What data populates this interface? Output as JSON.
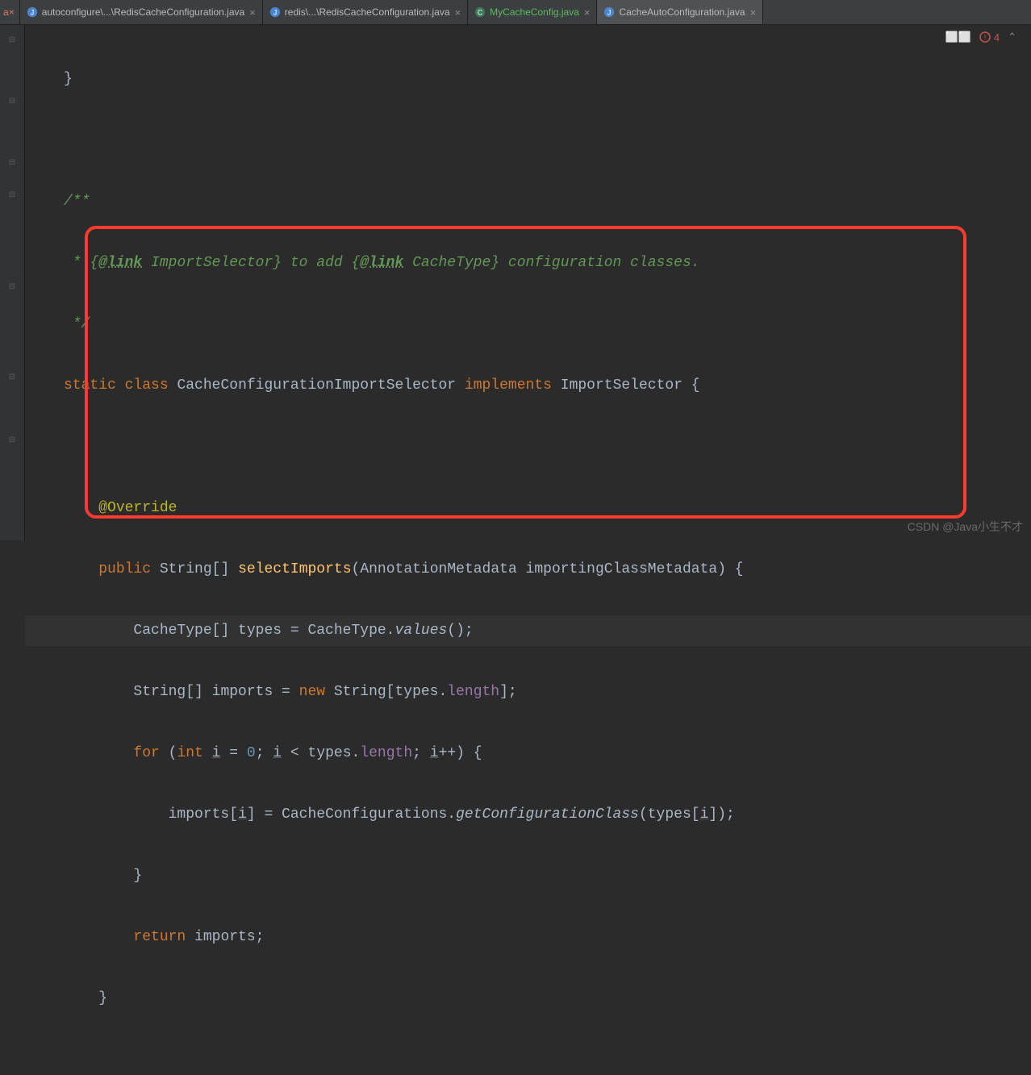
{
  "tabs": {
    "partial_close": "×",
    "t0": {
      "label": "autoconfigure\\...\\RedisCacheConfiguration.java",
      "close": "×"
    },
    "t1": {
      "label": "redis\\...\\RedisCacheConfiguration.java",
      "close": "×"
    },
    "t2": {
      "label": "MyCacheConfig.java",
      "close": "×"
    },
    "t3": {
      "label": "CacheAutoConfiguration.java",
      "close": "×"
    }
  },
  "status": {
    "err_count": "4",
    "chevron": "⌃"
  },
  "code": {
    "l1": "}",
    "l3": "/**",
    "l4_a": " * {",
    "l4_link1": "@link",
    "l4_b": " ImportSelector}",
    "l4_c": " to add {",
    "l4_link2": "@link",
    "l4_d": " CacheType}",
    "l4_e": " configuration classes.",
    "l5": " */",
    "l6_kw1": "static",
    "l6_kw2": "class",
    "l6_cls": "CacheConfigurationImportSelector",
    "l6_kw3": "implements",
    "l6_iface": "ImportSelector {",
    "l8_ann": "@Override",
    "l9_kw": "public",
    "l9_ret": "String[]",
    "l9_m": "selectImports",
    "l9_p": "(AnnotationMetadata importingClassMetadata) {",
    "l10_a": "CacheType[] types = CacheType.",
    "l10_m": "values",
    "l10_b": "();",
    "l11_a": "String[] imports = ",
    "l11_kw": "new",
    "l11_b": " String[types.",
    "l11_f": "length",
    "l11_c": "];",
    "l12_kw": "for",
    "l12_a": " (",
    "l12_int": "int",
    "l12_b": " ",
    "l12_i1": "i",
    "l12_c": " = ",
    "l12_num": "0",
    "l12_d": "; ",
    "l12_i2": "i",
    "l12_e": " < types.",
    "l12_f": "length",
    "l12_g": "; ",
    "l12_i3": "i",
    "l12_h": "++) {",
    "l13_a": "imports[",
    "l13_i": "i",
    "l13_b": "] = CacheConfigurations.",
    "l13_m": "getConfigurationClass",
    "l13_c": "(types[",
    "l13_i2": "i",
    "l13_d": "]);",
    "l14": "}",
    "l15_kw": "return",
    "l15_a": " imports;",
    "l16": "}"
  },
  "watermark": "CSDN @Java小生不才"
}
